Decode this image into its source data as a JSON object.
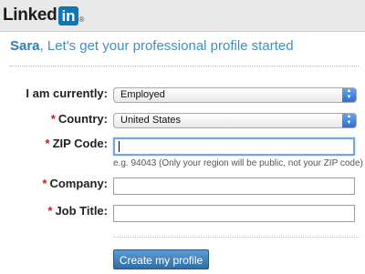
{
  "header": {
    "logo_text": "Linked",
    "logo_in": "in",
    "logo_reg": "®"
  },
  "page": {
    "name": "Sara",
    "heading_rest": ", Let's get your professional profile started"
  },
  "form": {
    "status": {
      "label": "I am currently:",
      "value": "Employed"
    },
    "country": {
      "required_mark": "*",
      "label": "Country:",
      "value": "United States"
    },
    "zip": {
      "required_mark": "*",
      "label": "ZIP Code:",
      "value": "",
      "hint": "e.g. 94043 (Only your region will be public, not your ZIP code)"
    },
    "company": {
      "required_mark": "*",
      "label": "Company:",
      "value": ""
    },
    "job_title": {
      "required_mark": "*",
      "label": "Job Title:",
      "value": ""
    },
    "submit_label": "Create my profile"
  },
  "colors": {
    "accent": "#3f8fc7",
    "logo_blue": "#0c77b5",
    "required": "#cc1b1b",
    "button": "#3a7cb6"
  }
}
